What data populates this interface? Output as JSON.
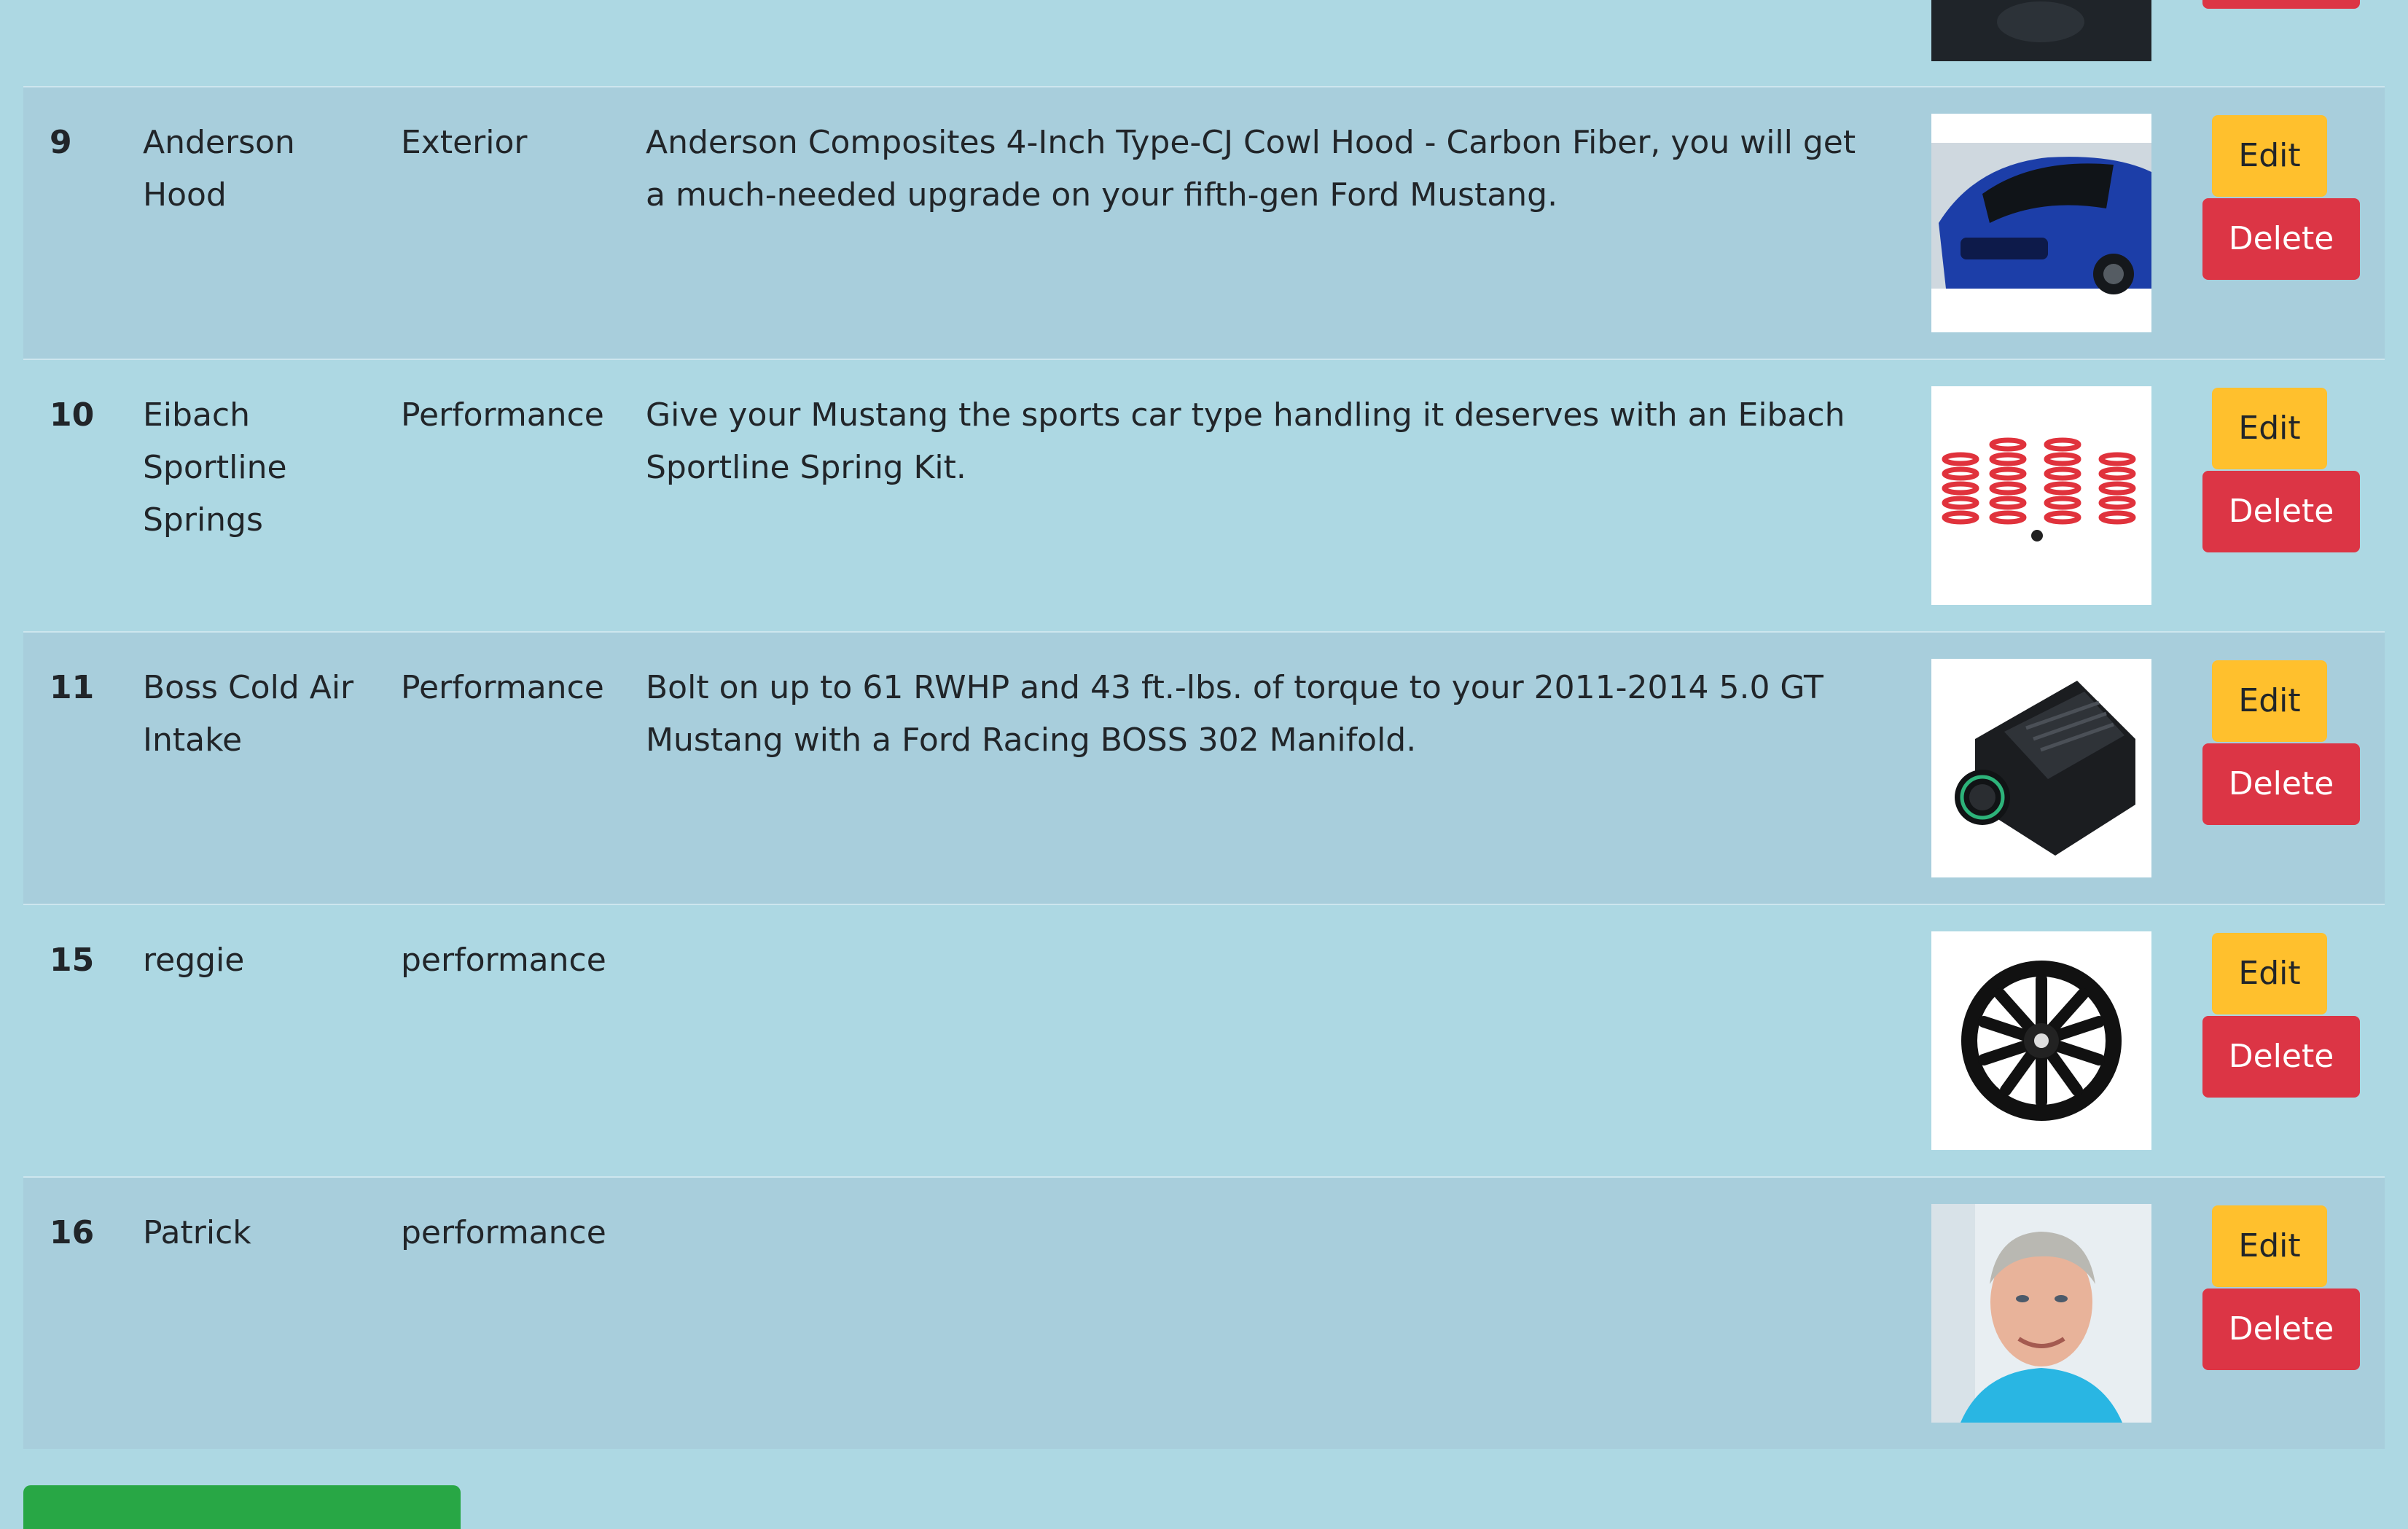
{
  "table": {
    "rows": [
      {
        "id": "9",
        "name": "Anderson Hood",
        "category": "Exterior",
        "description": "Anderson Composites 4-Inch Type-CJ Cowl Hood - Carbon Fiber, you will get a much-needed upgrade on your fifth-gen Ford Mustang.",
        "image_icon": "blue-mustang-image",
        "edit_label": "Edit",
        "delete_label": "Delete"
      },
      {
        "id": "10",
        "name": "Eibach Sportline Springs",
        "category": "Performance",
        "description": "Give your Mustang the sports car type handling it deserves with an Eibach Sportline Spring Kit.",
        "image_icon": "red-springs-image",
        "edit_label": "Edit",
        "delete_label": "Delete"
      },
      {
        "id": "11",
        "name": "Boss Cold Air Intake",
        "category": "Performance",
        "description": "Bolt on up to 61 RWHP and 43 ft.-lbs. of torque to your 2011-2014 5.0 GT Mustang with a Ford Racing BOSS 302 Manifold.",
        "image_icon": "intake-manifold-image",
        "edit_label": "Edit",
        "delete_label": "Delete"
      },
      {
        "id": "15",
        "name": "reggie",
        "category": "performance",
        "description": "",
        "image_icon": "black-wheel-image",
        "edit_label": "Edit",
        "delete_label": "Delete"
      },
      {
        "id": "16",
        "name": "Patrick",
        "category": "performance",
        "description": "",
        "image_icon": "portrait-photo-image",
        "edit_label": "Edit",
        "delete_label": "Delete"
      }
    ]
  },
  "colors": {
    "page_background": "#add8e3",
    "striped_row": "#a8cedc",
    "edit_button": "#ffc02d",
    "delete_button": "#dc3545",
    "add_button": "#28a745"
  }
}
